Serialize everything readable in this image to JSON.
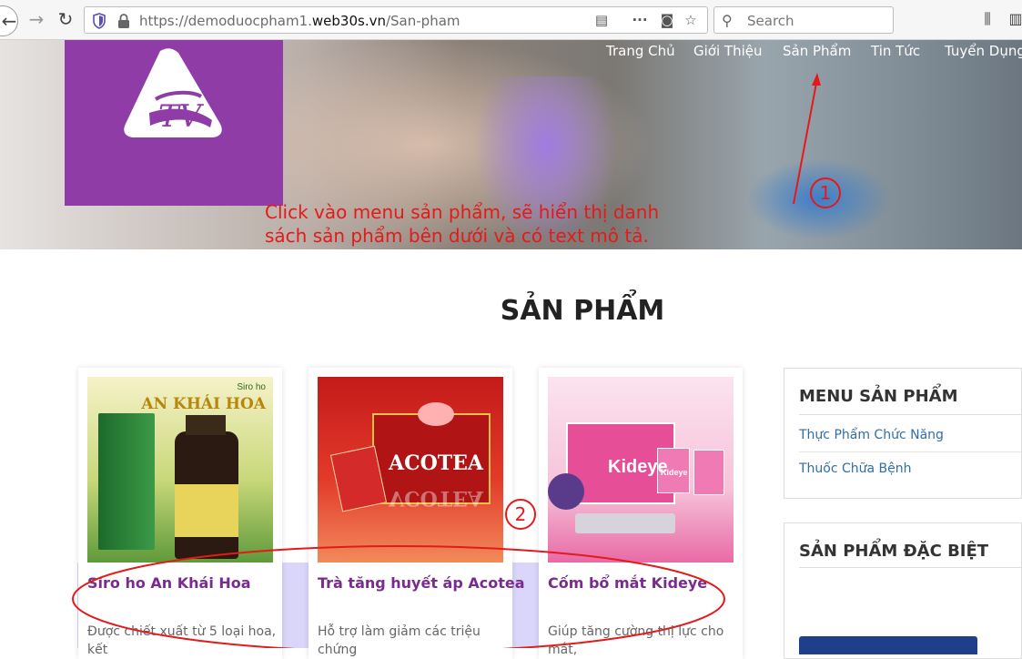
{
  "browser": {
    "url_prefix": "https://demoduocpham1.",
    "url_domain": "web30s.vn",
    "url_path": "/San-pham",
    "search_placeholder": "Search"
  },
  "nav": {
    "items": [
      "Trang Chủ",
      "Giới Thiệu",
      "Sản Phẩm",
      "Tin Tức",
      "Tuyển Dụng"
    ]
  },
  "annotation": {
    "line1": "Click vào menu sản phẩm, sẽ hiển thị danh",
    "line2": "sách sản phẩm bên dưới và có text mô tả.",
    "step1": "1",
    "step2": "2",
    "color": "#e41a1a"
  },
  "main": {
    "title": "SẢN PHẨM",
    "products": [
      {
        "name": "Siro ho An Khái Hoa",
        "desc": "Được chiết xuất từ 5 loại hoa, kết",
        "img_text_1": "Siro ho",
        "img_text_2": "AN KHÁI HOA"
      },
      {
        "name": "Trà tăng huyết áp Acotea",
        "desc": "Hỗ trợ làm giảm các triệu chứng",
        "img_text_1": "ACOTEA",
        "img_text_2": "VCOTEA"
      },
      {
        "name": "Cốm bổ mắt Kideye",
        "desc": "Giúp tăng cường thị lực cho mắt,",
        "img_text_1": "Kideye",
        "img_text_2": "Kideye"
      }
    ]
  },
  "sidebar": {
    "menu_title": "MENU SẢN PHẨM",
    "menu_items": [
      "Thực Phẩm Chức Năng",
      "Thuốc Chữa Bệnh"
    ],
    "special_title": "SẢN PHẨM ĐẶC BIỆT"
  },
  "colors": {
    "brand_purple": "#8f3ca6",
    "product_name": "#7a2b8e",
    "link_blue": "#2f6fa7"
  }
}
